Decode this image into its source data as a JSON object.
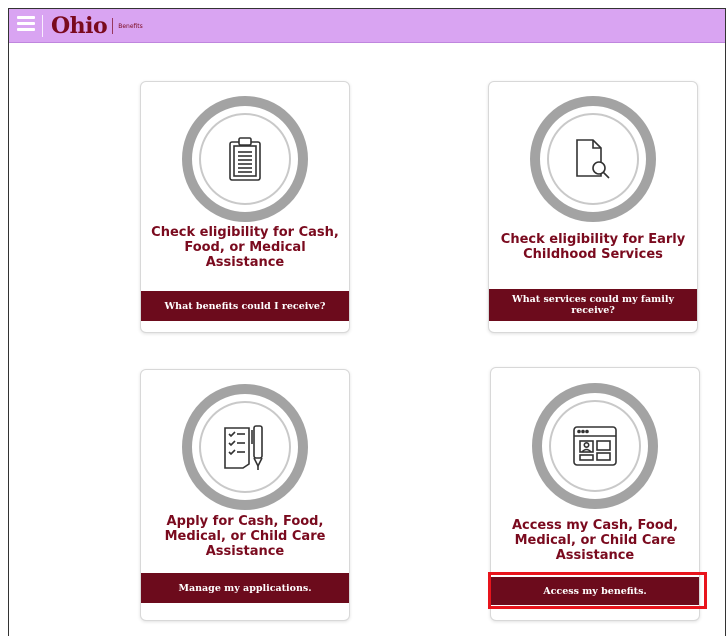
{
  "header": {
    "menu_icon": "hamburger-icon",
    "logo_text": "Ohio",
    "logo_subtext": "Benefits",
    "bar_color": "#d9a4f2"
  },
  "cards": [
    {
      "icon": "clipboard-icon",
      "title": "Check eligibility for Cash, Food, or Medical Assistance",
      "button": "What benefits could I receive?"
    },
    {
      "icon": "document-search-icon",
      "title": "Check eligibility for Early Childhood Services",
      "button": "What services could my family receive?"
    },
    {
      "icon": "checklist-pen-icon",
      "title": "Apply for Cash, Food, Medical, or Child Care Assistance",
      "button": "Manage my applications."
    },
    {
      "icon": "browser-window-icon",
      "title": "Access my Cash, Food, Medical, or Child Care Assistance",
      "button": "Access my benefits."
    }
  ],
  "colors": {
    "brand": "#7a0a1e",
    "button_bg": "#6c0b1c",
    "highlight": "#e8141c"
  }
}
